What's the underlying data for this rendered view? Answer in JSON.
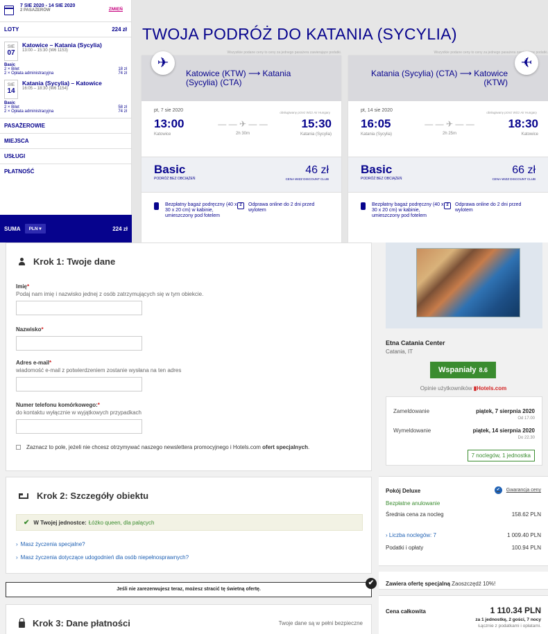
{
  "wizz": {
    "sidebar": {
      "dates": "7 SIE 2020 - 14 SIE 2020",
      "passengers": "2 PASAŻERÓW",
      "change_label": "ZMIEŃ",
      "flights_label": "LOTY",
      "flights_total": "224 zł",
      "outbound": {
        "day_name": "SIE",
        "day_num": "07",
        "route": "Katowice – Katania (Sycylia)",
        "time": "13:00 – 15:30 (W6 1153)"
      },
      "outbound_fare": {
        "name": "Basic",
        "line1_label": "2 × Bilet",
        "line1_value": "18 zł",
        "line2_label": "2 × Opłata administracyjna",
        "line2_value": "74 zł"
      },
      "inbound": {
        "day_name": "SIE",
        "day_num": "14",
        "route": "Katania (Sycylia) – Katowice",
        "time": "16:05 – 18:30 (W6 1154)"
      },
      "inbound_fare": {
        "name": "Basic",
        "line1_label": "2 × Bilet",
        "line1_value": "58 zł",
        "line2_label": "2 × Opłata administracyjna",
        "line2_value": "74 zł"
      },
      "sections": [
        "PASAŻEROWIE",
        "MIEJSCA",
        "USŁUGI",
        "PŁATNOŚĆ"
      ],
      "sum_label": "SUMA",
      "currency": "PLN",
      "sum_total": "224 zł"
    },
    "title": "TWOJA PODRÓŻ DO KATANIA (SYCYLIA)",
    "price_note": "Wszystkie podane ceny to ceny za jednego pasażera zawierające podatki.",
    "cards": [
      {
        "route": "Katowice (KTW) ⟶ Katania (Sycylia) (CTA)",
        "date": "pt, 7 sie 2020",
        "operator": "obsługiwany przez Wizz Air Hungary",
        "dep_time": "13:00",
        "arr_time": "15:30",
        "duration": "2h 30m",
        "dep_city": "Katowice",
        "arr_city": "Katania (Sycylia)",
        "fare_name": "Basic",
        "fare_sub": "PODRÓŻ BEZ OBCIĄŻEŃ",
        "price": "46 zł",
        "club": "CENA WIZZ DISCOUNT CLUB",
        "feature1": "Bezpłatny bagaż podręczny (40 x 30 x 20 cm) w kabinie, umieszczony pod fotelem",
        "feature2": "Odprawa online do 2 dni przed wylotem",
        "checkin_icon_label": "2"
      },
      {
        "route": "Katania (Sycylia) (CTA) ⟶ Katowice (KTW)",
        "date": "pt, 14 sie 2020",
        "operator": "obsługiwany przez Wizz Air Hungary",
        "dep_time": "16:05",
        "arr_time": "18:30",
        "duration": "2h 25m",
        "dep_city": "Katania (Sycylia)",
        "arr_city": "Katowice",
        "fare_name": "Basic",
        "fare_sub": "PODRÓŻ BEZ OBCIĄŻEŃ",
        "price": "66 zł",
        "club": "CENA WIZZ DISCOUNT CLUB",
        "feature1": "Bezpłatny bagaż podręczny (40 x 30 x 20 cm) w kabinie, umieszczony pod fotelem",
        "feature2": "Odprawa online do 2 dni przed wylotem",
        "checkin_icon_label": "2"
      }
    ]
  },
  "hotels": {
    "step1": {
      "title": "Krok 1: Twoje dane",
      "first_name": {
        "label": "Imię",
        "hint": "Podaj nam imię i nazwisko jednej z osób zatrzymujących się w tym obiekcie.",
        "value": ""
      },
      "last_name": {
        "label": "Nazwisko",
        "value": ""
      },
      "email": {
        "label": "Adres e-mail",
        "hint": "wiadomość e-mail z potwierdzeniem zostanie wysłana na ten adres",
        "value": ""
      },
      "phone": {
        "label": "Numer telefonu komórkowego:",
        "hint": "do kontaktu wyłącznie w wyjątkowych przypadkach",
        "value": ""
      },
      "newsletter_text": "Zaznacz to pole, jeżeli nie chcesz otrzymywać naszego newslettera promocyjnego i Hotels.com",
      "newsletter_bold": "ofert specjalnych",
      "newsletter_end": "."
    },
    "step2": {
      "title": "Krok 2: Szczegóły obiektu",
      "unit_label": "W Twojej jednostce:",
      "unit_value": "Łóżko queen, dla palących",
      "link1": "Masz życzenia specjalne?",
      "link2": "Masz życzenia dotyczące udogodnień dla osób niepełnosprawnych?"
    },
    "urgency": "Jeśli nie zarezerwujesz teraz, możesz stracić tę świetną ofertę.",
    "step3": {
      "title": "Krok 3: Dane płatności",
      "note": "Twoje dane są w pełni bezpieczne"
    },
    "summary": {
      "hotel_name": "Etna Catania Center",
      "location": "Catania, IT",
      "rating_label": "Wspaniały",
      "rating_score": "8.6",
      "reviews_text": "Opinie użytkowników",
      "reviews_brand": "Hotels.com",
      "checkin_label": "Zameldowanie",
      "checkin_date": "piątek, 7 sierpnia 2020",
      "checkin_time": "Od 17.00",
      "checkout_label": "Wymeldowanie",
      "checkout_date": "piątek, 14 sierpnia 2020",
      "checkout_time": "Do 22.30",
      "nights": "7 noclegów, 1 jednostka",
      "room": "Pokój Deluxe",
      "guarantee": "Gwarancja ceny",
      "free_cancel": "Bezpłatne anulowanie",
      "avg_label": "Średnia cena za nocleg",
      "avg_value": "158.62 PLN",
      "nights_label": "Liczba noclegów: 7",
      "nights_value": "1 009.40 PLN",
      "tax_label": "Podatki i opłaty",
      "tax_value": "100.94 PLN",
      "offer_bold": "Zawiera ofertę specjalną",
      "offer_rest": "Zaoszczędź 10%!",
      "total_label": "Cena całkowita",
      "total_value": "1 110.34 PLN",
      "total_sub": "za 1 jednostkę, 2 gości, 7 nocy",
      "total_sub2": "Łącznie z podatkami i opłatami."
    }
  },
  "colors": {
    "wizz_blue": "#06038d",
    "wizz_pink": "#c6007e",
    "green": "#3a8c2f",
    "link": "#1f61b4"
  }
}
